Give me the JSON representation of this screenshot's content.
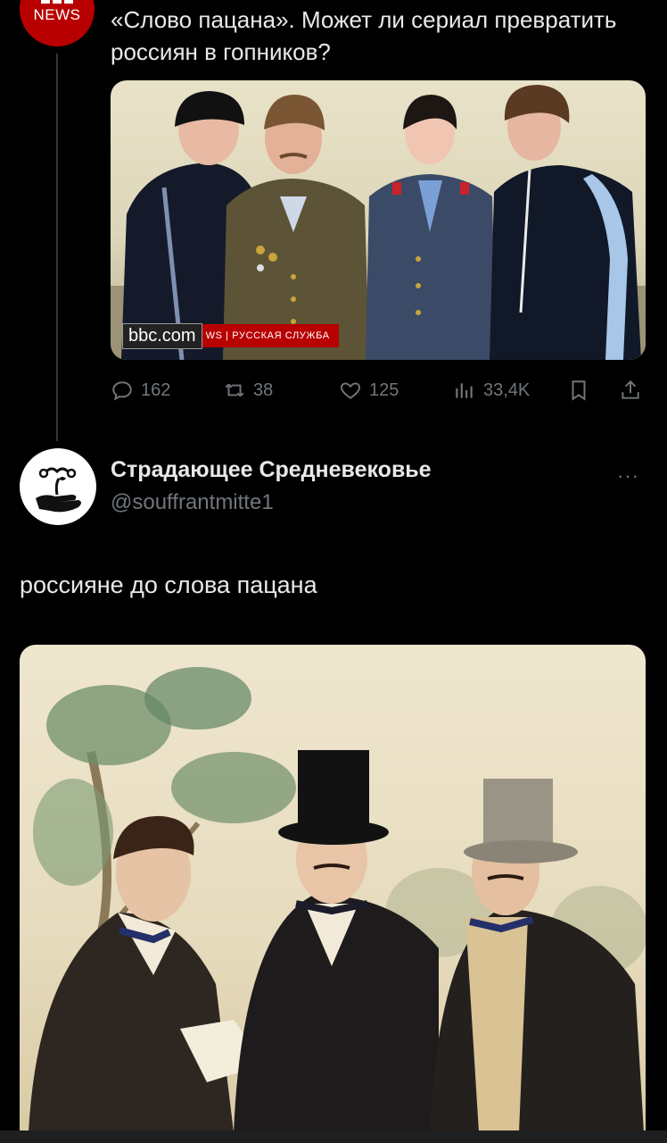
{
  "tweet_bbc": {
    "avatar_text": "NEWS",
    "text": "«Слово пацана». Может ли сериал превратить россиян в гопников?",
    "image": {
      "watermark_site": "bbc.com",
      "watermark_tail_ws": "WS",
      "watermark_service": "РУССКАЯ СЛУЖБА"
    },
    "actions": {
      "replies": "162",
      "reposts": "38",
      "likes": "125",
      "views": "33,4K"
    }
  },
  "tweet_reply": {
    "display_name": "Страдающее Средневековье",
    "handle": "@souffrantmitte1",
    "more": "···",
    "text": "россияне до слова пацана"
  },
  "colors": {
    "background": "#000000",
    "text_primary": "#e7e9ea",
    "text_secondary": "#71767b",
    "bbc_red": "#b80000"
  }
}
